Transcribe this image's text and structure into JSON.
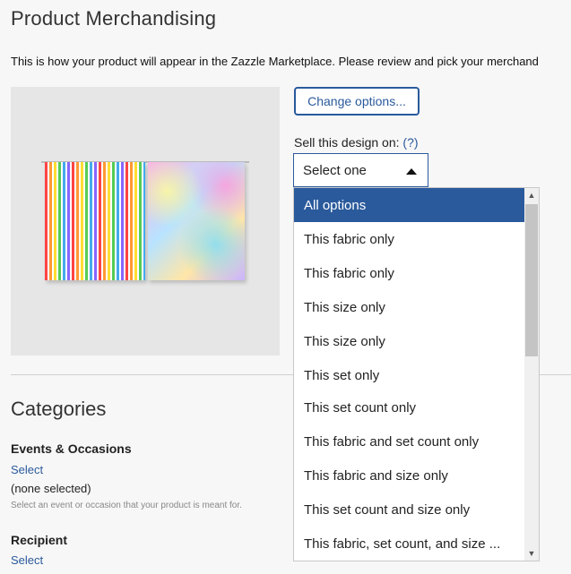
{
  "page": {
    "title": "Product Merchandising",
    "intro": "This is how your product will appear in the Zazzle Marketplace. Please review and pick your merchand"
  },
  "options": {
    "change_label": "Change options...",
    "sell_label": "Sell this design on:",
    "sell_help": "(?)",
    "select_value": "Select one"
  },
  "dropdown": {
    "items": [
      "All options",
      "This fabric only",
      "This fabric only",
      "This size only",
      "This size only",
      "This set only",
      "This set count only",
      "This fabric and set count only",
      "This fabric and size only",
      "This set count and size only",
      "This fabric, set count, and size ..."
    ],
    "selected_index": 0
  },
  "categories": {
    "title": "Categories",
    "events_heading": "Events & Occasions",
    "events_select": "Select",
    "events_none": "(none selected)",
    "events_hint": "Select an event or occasion that your product is meant for.",
    "recipient_heading": "Recipient",
    "recipient_select": "Select"
  },
  "colors": {
    "accent": "#2a5a9c"
  }
}
